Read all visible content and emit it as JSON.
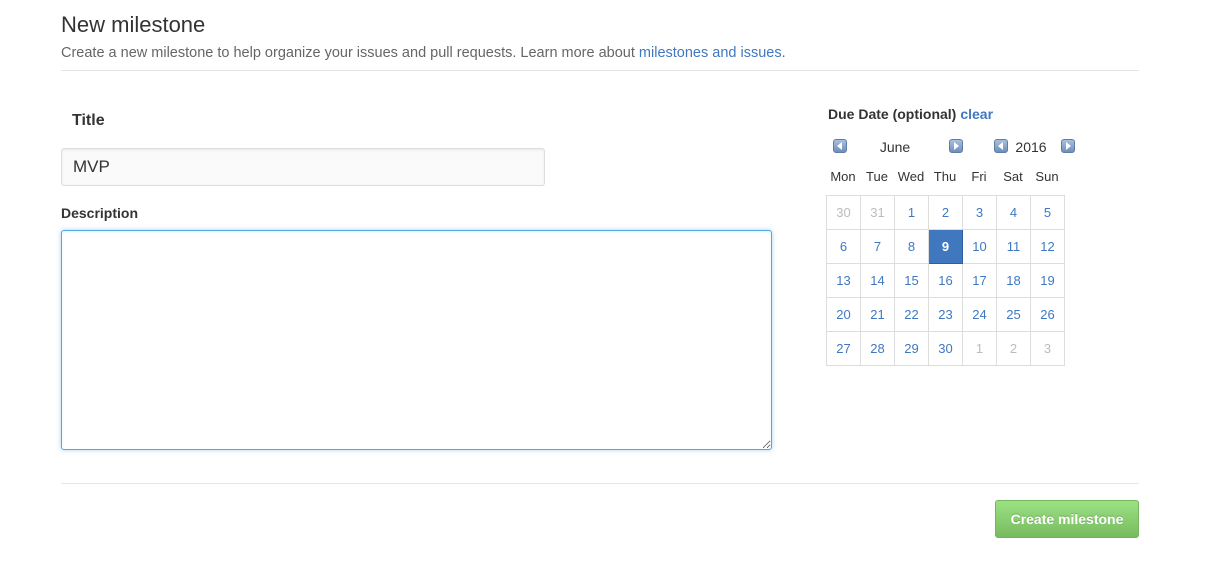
{
  "header": {
    "title": "New milestone",
    "subtitle_prefix": "Create a new milestone to help organize your issues and pull requests. Learn more about ",
    "subtitle_link": "milestones and issues",
    "subtitle_suffix": "."
  },
  "form": {
    "title_label": "Title",
    "title_value": "MVP",
    "description_label": "Description",
    "description_value": ""
  },
  "due_date": {
    "label": "Due Date (optional)",
    "clear_label": "clear",
    "month": "June",
    "year": "2016",
    "weekdays": [
      "Mon",
      "Tue",
      "Wed",
      "Thu",
      "Fri",
      "Sat",
      "Sun"
    ],
    "weeks": [
      [
        {
          "d": "30",
          "other": true
        },
        {
          "d": "31",
          "other": true
        },
        {
          "d": "1"
        },
        {
          "d": "2"
        },
        {
          "d": "3"
        },
        {
          "d": "4"
        },
        {
          "d": "5"
        }
      ],
      [
        {
          "d": "6"
        },
        {
          "d": "7"
        },
        {
          "d": "8"
        },
        {
          "d": "9",
          "selected": true
        },
        {
          "d": "10"
        },
        {
          "d": "11"
        },
        {
          "d": "12"
        }
      ],
      [
        {
          "d": "13"
        },
        {
          "d": "14"
        },
        {
          "d": "15"
        },
        {
          "d": "16"
        },
        {
          "d": "17"
        },
        {
          "d": "18"
        },
        {
          "d": "19"
        }
      ],
      [
        {
          "d": "20"
        },
        {
          "d": "21"
        },
        {
          "d": "22"
        },
        {
          "d": "23"
        },
        {
          "d": "24"
        },
        {
          "d": "25"
        },
        {
          "d": "26"
        }
      ],
      [
        {
          "d": "27"
        },
        {
          "d": "28"
        },
        {
          "d": "29"
        },
        {
          "d": "30"
        },
        {
          "d": "1",
          "other": true
        },
        {
          "d": "2",
          "other": true
        },
        {
          "d": "3",
          "other": true
        }
      ]
    ]
  },
  "actions": {
    "create_label": "Create milestone"
  },
  "colors": {
    "link": "#4078c0",
    "selected_day": "#4078c0",
    "create_button": "#60b044"
  }
}
